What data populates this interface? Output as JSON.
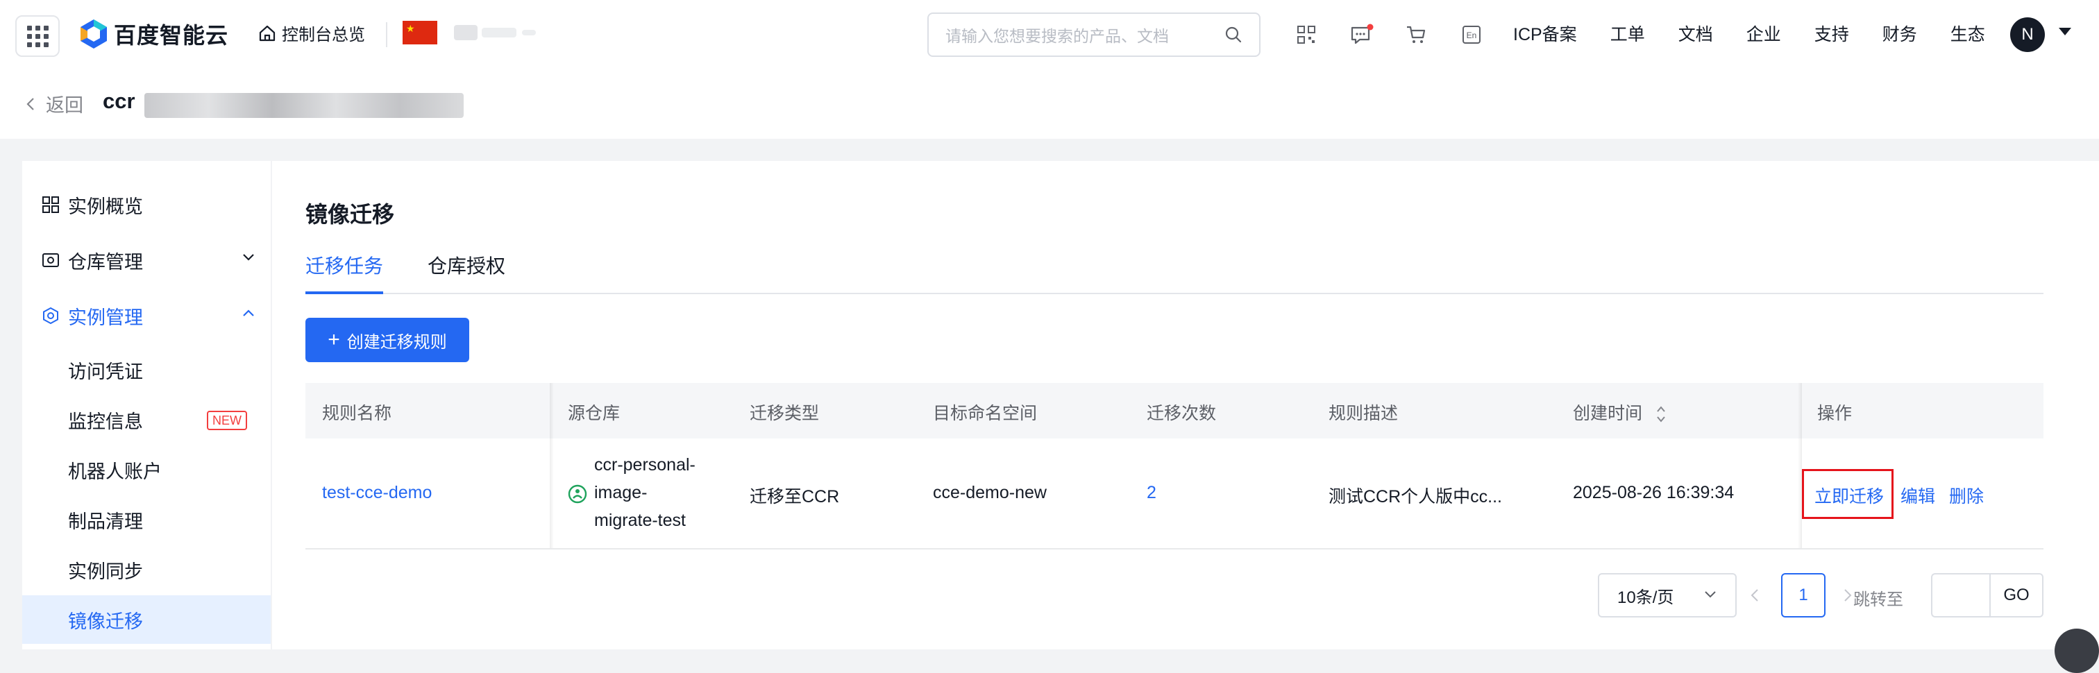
{
  "topnav": {
    "logo_text": "百度智能云",
    "console_home": "控制台总览",
    "search_placeholder": "请输入您想要搜索的产品、文档",
    "icons": [
      "qrcode-icon",
      "message-icon",
      "cart-icon",
      "language-en-icon"
    ],
    "en_icon_text": "En",
    "links": [
      "ICP备案",
      "工单",
      "文档",
      "企业",
      "支持",
      "财务",
      "生态"
    ],
    "avatar_letter": "N"
  },
  "header": {
    "back_label": "返回",
    "instance_prefix": "ccr"
  },
  "sidebar": {
    "items": [
      {
        "label": "实例概览",
        "icon": "grid-icon"
      },
      {
        "label": "仓库管理",
        "icon": "repository-icon",
        "chevron": "down"
      },
      {
        "label": "实例管理",
        "icon": "instance-icon",
        "chevron": "up"
      }
    ],
    "sub_items": [
      {
        "label": "访问凭证"
      },
      {
        "label": "监控信息",
        "badge": "NEW"
      },
      {
        "label": "机器人账户"
      },
      {
        "label": "制品清理"
      },
      {
        "label": "实例同步"
      },
      {
        "label": "镜像迁移"
      }
    ]
  },
  "main": {
    "title": "镜像迁移",
    "tabs": [
      "迁移任务",
      "仓库授权"
    ],
    "create_button": "创建迁移规则",
    "table": {
      "columns": [
        "规则名称",
        "源仓库",
        "迁移类型",
        "目标命名空间",
        "迁移次数",
        "规则描述",
        "创建时间",
        "操作"
      ],
      "rows": [
        {
          "name": "test-cce-demo",
          "source_line1": "ccr-personal-",
          "source_line2": "image-",
          "source_line3": "migrate-test",
          "type": "迁移至CCR",
          "namespace": "cce-demo-new",
          "count": "2",
          "description": "测试CCR个人版中cc...",
          "created": "2025-08-26 16:39:34",
          "actions": [
            "立即迁移",
            "编辑",
            "删除"
          ]
        }
      ]
    },
    "pagination": {
      "page_size": "10条/页",
      "current_page": "1",
      "jump_label": "跳转至",
      "go_label": "GO"
    }
  },
  "colors": {
    "accent": "#2468f2",
    "text": "#151b26",
    "muted": "#84868c",
    "highlight_box": "#e5141b",
    "badge": "#f33e3e"
  }
}
